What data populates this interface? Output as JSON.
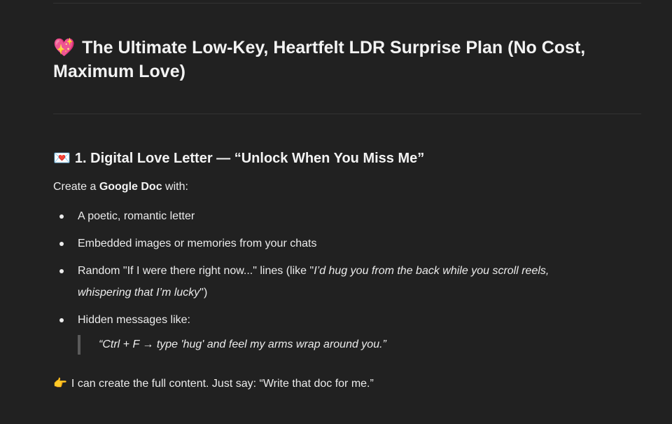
{
  "heading": {
    "emoji": "💖",
    "title_line1": "The Ultimate Low-Key, Heartfelt LDR Surprise Plan (No Cost,",
    "title_line2": "Maximum Love)"
  },
  "section1": {
    "emoji": "💌",
    "title": "1. Digital Love Letter — “Unlock When You Miss Me”",
    "intro_prefix": "Create a ",
    "intro_bold": "Google Doc",
    "intro_suffix": " with:",
    "bullets": {
      "b1": "A poetic, romantic letter",
      "b2": "Embedded images or memories from your chats",
      "b3_prefix": "Random \"If I were there right now...\" lines (like \"",
      "b3_italic_line1": "I’d hug you from the back while you scroll reels,",
      "b3_italic_line2": "whispering that I’m lucky",
      "b3_suffix": "\")",
      "b4": "Hidden messages like:"
    },
    "quote": "“Ctrl + F → type 'hug' and feel my arms wrap around you.”",
    "cta_emoji": "👉",
    "cta": "I can create the full content. Just say: “Write that doc for me.”"
  }
}
